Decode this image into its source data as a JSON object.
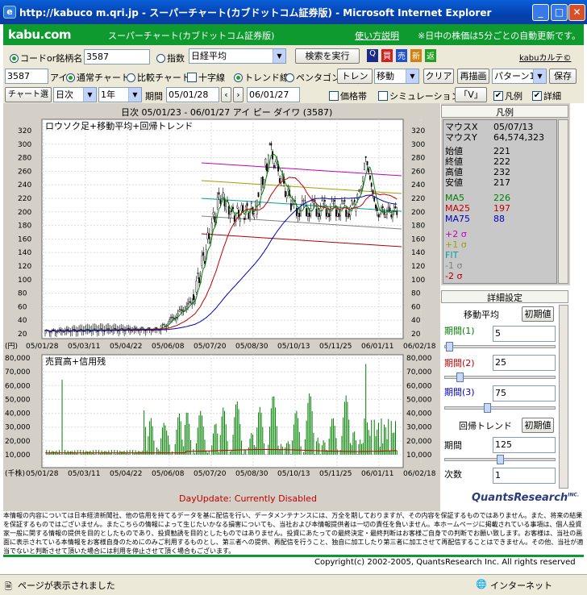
{
  "window": {
    "title": "http://kabuco m.qri.jp - スーパーチャート(カブドットコム証券版) - Microsoft Internet Explorer"
  },
  "header": {
    "logo": "kabu.com",
    "title": "スーパーチャート(カブドットコム証券版)",
    "help_link": "使い方説明",
    "note": "※日中の株価は5分ごとの自動更新です。"
  },
  "search": {
    "code_radio": "コードor銘柄名",
    "code_value": "3587",
    "index_radio": "指数",
    "index_select": "日経平均",
    "run_button": "検索を実行",
    "icons": [
      "Q",
      "買",
      "売",
      "新",
      "返"
    ],
    "karte_link": "kabuカルテ©"
  },
  "toolbar1": {
    "code": "3587",
    "label_ai": "アイ",
    "normal_chart": "通常チャート",
    "compare_chart": "比較チャート",
    "cross": "十字線",
    "trend": "トレンド線",
    "pentagon": "ペンタゴン",
    "trend_color_btn": "トレンド色",
    "move_select": "移動",
    "clear_btn": "クリア",
    "redraw_btn": "再描画",
    "pattern_select": "パターン1",
    "save_btn": "保存"
  },
  "toolbar2": {
    "chart_select_btn": "チャート選択",
    "period_type": "日次",
    "range": "1年",
    "period_label": "期間",
    "from": "05/01/28",
    "to": "06/01/27",
    "price_band": "価格帯",
    "simulation": "シミュレーション",
    "v_btn": "「V」",
    "legend_chk": "凡例",
    "detail_chk": "詳細"
  },
  "chart_title": "日次 05/01/23 - 06/01/27  アイ ピー ダイワ (3587)",
  "main_chart": {
    "panel_label": "ロウソク足+移動平均+回帰トレンド",
    "y_ticks": [
      "320",
      "300",
      "280",
      "260",
      "240",
      "220",
      "200",
      "180",
      "160",
      "140",
      "120",
      "100",
      "80",
      "60",
      "40",
      "20"
    ],
    "x_ticks": [
      "05/01/28",
      "05/03/11",
      "05/04/22",
      "05/06/08",
      "05/07/20",
      "05/08/30",
      "05/10/13",
      "05/11/25",
      "06/01/11",
      "06/02/18"
    ],
    "x_prefix": "(円)"
  },
  "volume_chart": {
    "panel_label": "売買高+信用残",
    "y_ticks": [
      "80,000",
      "70,000",
      "60,000",
      "50,000",
      "40,000",
      "30,000",
      "20,000",
      "10,000"
    ],
    "x_prefix": "(千株)"
  },
  "chart_data": {
    "type": "line",
    "x": [
      "05/01/28",
      "05/03/11",
      "05/04/22",
      "05/06/08",
      "05/07/20",
      "05/08/30",
      "05/10/13",
      "05/11/25",
      "06/01/11",
      "06/02/18"
    ],
    "series": [
      {
        "name": "MA5",
        "values": [
          22,
          25,
          28,
          40,
          235,
          280,
          205,
          210,
          220,
          196
        ]
      },
      {
        "name": "MA25",
        "values": [
          22,
          24,
          26,
          35,
          190,
          235,
          210,
          200,
          205,
          197
        ]
      },
      {
        "name": "MA75",
        "values": [
          22,
          23,
          25,
          28,
          150,
          200,
          205,
          200,
          200,
          88
        ]
      }
    ],
    "ylim": [
      20,
      320
    ]
  },
  "legend": {
    "title": "凡例",
    "date_label": "マウスX",
    "date_value": "05/07/13",
    "vol_label": "マウスY",
    "vol_value": "64,574,323",
    "open_label": "始値",
    "open_value": "221",
    "close_label": "終値",
    "close_value": "222",
    "high_label": "高値",
    "high_value": "232",
    "low_label": "安値",
    "low_value": "217",
    "ma5_label": "MA5",
    "ma5_value": "226",
    "ma25_label": "MA25",
    "ma25_value": "197",
    "ma75_label": "MA75",
    "ma75_value": "88",
    "sigma": [
      "+2 σ",
      "+1 σ",
      "FIT",
      "-1 σ",
      "-2 σ"
    ],
    "sigma_colors": [
      "#c000c0",
      "#a0a000",
      "#00a0a0",
      "#808080",
      "#b00000"
    ]
  },
  "detail": {
    "title": "詳細設定",
    "ma_title": "移動平均",
    "init_btn": "初期値",
    "period1_label": "期間(1)",
    "period1": "5",
    "period2_label": "期間(2)",
    "period2": "25",
    "period3_label": "期間(3)",
    "period3": "75",
    "trend_title": "回帰トレンド",
    "init_btn2": "初期値",
    "period_label": "期間",
    "period": "125",
    "dim_label": "次数",
    "dim": "1"
  },
  "footer": {
    "dayupdate": "DayUpdate: Currently Disabled",
    "brand": "QuantsResearch",
    "brand_suffix": "INC.",
    "disclaimer": "本情報の内容については日本経済新聞社、他の信用を持てるデータを基に配信を行い、データメンテナンスには、万全を期しておりますが、その内容を保証するものではありません。また、将来の結果を保証するものではございません。またこちらの情報によって生じたいかなる損害についても、当社および本情報提供者は一切の責任を負いません。本ホームページに掲載されている事項は、個人投資家一般に関する情報の提供を目的としたものであり、投資勧誘を目的としたものではありません。投資にあたっての最終決定・最終判断はお客様ご自身での判断でお願い致します。お客様は、当社の画面に表示されている本情報をお客様自身のためにのみご利用するものとし、第三者への提供、再配信を行うこと、独自に加工したり第三者に加工させて再配信することはできません。その他、当社が適当でないと判断させて頂いた場合には利用を停止させて頂く場合もございます。",
    "copyright": "Copyright(c) 2002-2005, QuantsResearch Inc. All rights reserved"
  },
  "statusbar": {
    "text": "ページが表示されました",
    "zone": "インターネット"
  }
}
